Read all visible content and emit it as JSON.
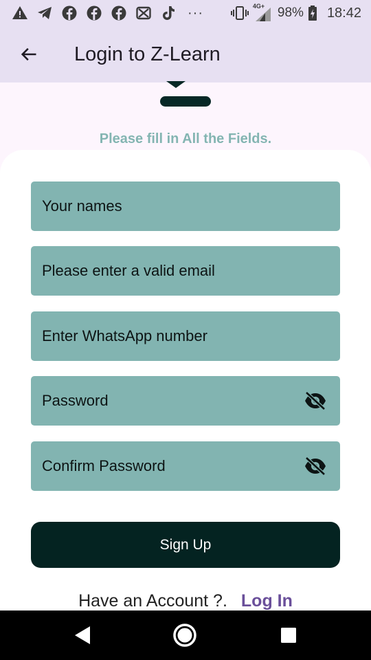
{
  "status_bar": {
    "left_icons": [
      "warning-icon",
      "telegram-icon",
      "facebook-icon",
      "facebook-icon",
      "facebook-icon",
      "capcut-icon",
      "tiktok-icon"
    ],
    "more": "···",
    "network": "4G+",
    "battery": "98%",
    "time": "18:42"
  },
  "app_bar": {
    "back_icon": "arrow-left-icon",
    "title": "Login to Z-Learn"
  },
  "instruction": "Please fill in All the Fields.",
  "form": {
    "name_placeholder": "Your names",
    "email_placeholder": "Please enter a valid email",
    "whatsapp_placeholder": "Enter WhatsApp number",
    "password_placeholder": "Password",
    "confirm_password_placeholder": "Confirm Password",
    "visibility_icon": "eye-off-icon",
    "signup_label": "Sign Up"
  },
  "footer": {
    "question": "Have an Account ?.",
    "login_label": "Log In"
  },
  "colors": {
    "appbar_bg": "#e7e0f2",
    "field_bg": "#82b4b1",
    "button_bg": "#042321",
    "instruction": "#84b5b2",
    "link": "#6a4f9a"
  },
  "nav_bar": {
    "icons": [
      "back-triangle-icon",
      "home-circle-icon",
      "recents-square-icon"
    ]
  }
}
